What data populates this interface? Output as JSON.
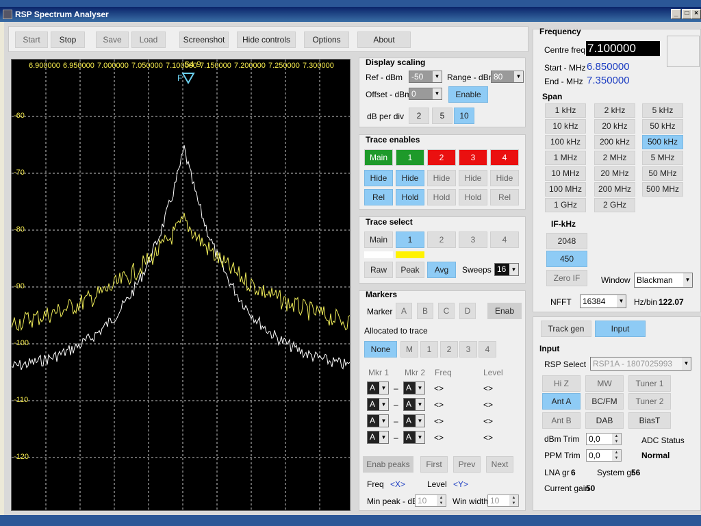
{
  "window": {
    "title": "RSP Spectrum Analyser"
  },
  "toolbar": {
    "start": "Start",
    "stop": "Stop",
    "save": "Save",
    "load": "Load",
    "screenshot": "Screenshot",
    "hide_controls": "Hide controls",
    "options": "Options",
    "about": "About"
  },
  "spectrum": {
    "freq_labels": [
      "6.900000",
      "6.950000",
      "7.000000",
      "7.050000",
      "7.100000",
      "7.150000",
      "7.200000",
      "7.250000",
      "7.300000"
    ],
    "db_labels": [
      "-60",
      "-70",
      "-80",
      "-90",
      "-100",
      "-110",
      "-120"
    ],
    "marker_label": "F",
    "marker_text": "S4 9",
    "trace_colors": {
      "main": "#ffffff",
      "trace1": "#f2ef5a"
    }
  },
  "display_scaling": {
    "title": "Display scaling",
    "ref_label": "Ref - dBm",
    "ref_value": "-50",
    "range_label": "Range - dBm",
    "range_value": "80",
    "offset_label": "Offset - dBm",
    "offset_value": "0",
    "enable": "Enable",
    "dbperdiv_label": "dB per div",
    "dbperdiv_options": [
      "2",
      "5",
      "10"
    ],
    "dbperdiv_selected": "10"
  },
  "trace_enables": {
    "title": "Trace enables",
    "headers": [
      "Main",
      "1",
      "2",
      "3",
      "4"
    ],
    "hide_row": [
      "Hide",
      "Hide",
      "Hide",
      "Hide",
      "Hide"
    ],
    "mode_row": [
      "Rel",
      "Hold",
      "Hold",
      "Hold",
      "Rel"
    ]
  },
  "trace_select": {
    "title": "Trace select",
    "traces": [
      "Main",
      "1",
      "2",
      "3",
      "4"
    ],
    "selected": "1",
    "swatches": [
      "#ffffff",
      "#fff200"
    ],
    "modes": [
      "Raw",
      "Peak",
      "Avg"
    ],
    "mode_selected": "Avg",
    "sweeps_label": "Sweeps",
    "sweeps_value": "16"
  },
  "markers": {
    "title": "Markers",
    "marker_label": "Marker",
    "letters": [
      "A",
      "B",
      "C",
      "D"
    ],
    "enab": "Enab",
    "allocated_label": "Allocated to trace",
    "alloc": [
      "None",
      "M",
      "1",
      "2",
      "3",
      "4"
    ],
    "col_mkr1": "Mkr 1",
    "col_mkr2": "Mkr 2",
    "col_freq": "Freq",
    "col_level": "Level",
    "rows": [
      {
        "m1": "A",
        "m2": "A",
        "dash": "–",
        "freq": "<>",
        "level": "<>"
      },
      {
        "m1": "A",
        "m2": "A",
        "dash": "–",
        "freq": "<>",
        "level": "<>"
      },
      {
        "m1": "A",
        "m2": "A",
        "dash": "–",
        "freq": "<>",
        "level": "<>"
      },
      {
        "m1": "A",
        "m2": "A",
        "dash": "–",
        "freq": "<>",
        "level": "<>"
      }
    ],
    "enab_peaks": "Enab peaks",
    "first": "First",
    "prev": "Prev",
    "next": "Next",
    "freq_label": "Freq",
    "freq_value": "<X>",
    "level_label": "Level",
    "level_value": "<Y>",
    "minpeak_label": "Min peak - dB",
    "minpeak_value": "10",
    "winwidth_label": "Win width",
    "winwidth_value": "10"
  },
  "frequency": {
    "title": "Frequency",
    "centre_label": "Centre freq",
    "centre_value": "7.100000",
    "start_label": "Start - MHz",
    "start_value": "6.850000",
    "end_label": "End - MHz",
    "end_value": "7.350000",
    "span_title": "Span",
    "span_buttons": [
      "1 kHz",
      "2 kHz",
      "5 kHz",
      "10 kHz",
      "20 kHz",
      "50 kHz",
      "100 kHz",
      "200 kHz",
      "500 kHz",
      "1 MHz",
      "2 MHz",
      "5 MHz",
      "10 MHz",
      "20 MHz",
      "50 MHz",
      "100 MHz",
      "200 MHz",
      "500 MHz",
      "1 GHz",
      "2 GHz"
    ],
    "span_selected": "500 kHz",
    "if_title": "IF-kHz",
    "if_buttons": [
      "2048",
      "450",
      "Zero IF"
    ],
    "if_selected": "450",
    "window_label": "Window",
    "window_value": "Blackman",
    "nfft_label": "NFFT",
    "nfft_value": "16384",
    "hzbin_label": "Hz/bin",
    "hzbin_value": "122.07"
  },
  "input": {
    "tab_trackgen": "Track gen",
    "tab_input": "Input",
    "title": "Input",
    "rsp_label": "RSP Select",
    "rsp_value": "RSP1A - 1807025993",
    "buttons": [
      "Hi Z",
      "MW",
      "Tuner 1",
      "Ant A",
      "BC/FM",
      "Tuner 2",
      "Ant B",
      "DAB",
      "BiasT"
    ],
    "selected": "Ant A",
    "dbm_trim_label": "dBm Trim",
    "dbm_trim_value": "0,0",
    "ppm_trim_label": "PPM Trim",
    "ppm_trim_value": "0,0",
    "adc_label": "ADC Status",
    "adc_value": "Normal",
    "lna_label": "LNA gr",
    "lna_value": "6",
    "sysgr_label": "System gr",
    "sysgr_value": "56",
    "current_label": "Current gain",
    "current_value": "50"
  }
}
